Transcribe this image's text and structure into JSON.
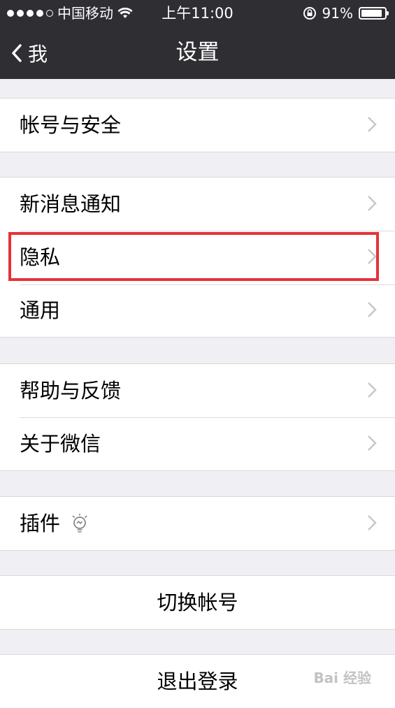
{
  "status_bar": {
    "carrier": "中国移动",
    "time": "上午11:00",
    "battery": "91%",
    "battery_level": 0.91
  },
  "nav": {
    "back_label": "我",
    "title": "设置"
  },
  "groups": [
    {
      "items": [
        {
          "label": "帐号与安全"
        }
      ]
    },
    {
      "items": [
        {
          "label": "新消息通知"
        },
        {
          "label": "隐私"
        },
        {
          "label": "通用"
        }
      ]
    },
    {
      "items": [
        {
          "label": "帮助与反馈"
        },
        {
          "label": "关于微信"
        }
      ]
    },
    {
      "items": [
        {
          "label": "插件"
        }
      ]
    }
  ],
  "actions": {
    "switch_account": "切换帐号",
    "logout": "退出登录"
  },
  "watermark": "Bai 经验",
  "colors": {
    "nav_bg": "#2e2e33",
    "page_bg": "#efeff4",
    "highlight": "#e63238"
  }
}
